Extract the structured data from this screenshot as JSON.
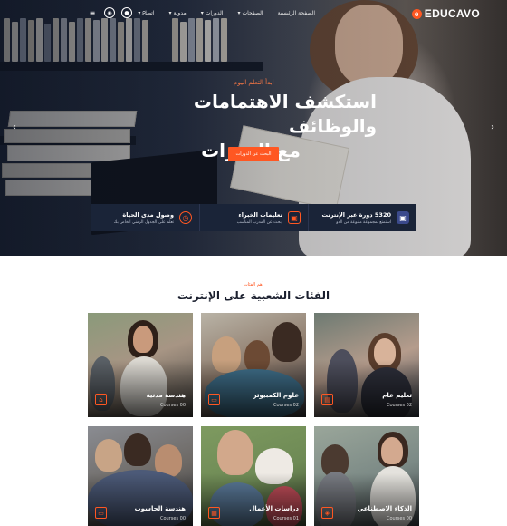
{
  "logo": {
    "text": "EDUCAVO"
  },
  "nav": {
    "items": [
      {
        "label": "الصفحة الرئيسية",
        "has_dropdown": false
      },
      {
        "label": "الصفحات",
        "has_dropdown": true
      },
      {
        "label": "الدورات",
        "has_dropdown": true
      },
      {
        "label": "مدونة",
        "has_dropdown": true
      },
      {
        "label": "اتصل",
        "has_dropdown": true
      }
    ]
  },
  "tools": {
    "menu_icon": "≡",
    "user_icon": "◉",
    "cart_icon": "●",
    "search_icon": "⌕"
  },
  "hero": {
    "eyebrow": "ابدأ التعلم اليوم",
    "headline_line1": "استكشف الاهتمامات والوظائف",
    "headline_line2": "مع الدورات",
    "button": "البحث عن الدورات",
    "prev_arrow": "‹",
    "next_arrow": "›"
  },
  "features": [
    {
      "title": "5320 دورة عبر الإنترنت",
      "subtitle": "استمتع بمجموعة متنوعة من الدو",
      "icon": "▣",
      "color": "#3b4a8c"
    },
    {
      "title": "تعليمات الخبراء",
      "subtitle": "ابحث عن المدرب المناسب",
      "icon": "▣",
      "color": "#ff5722"
    },
    {
      "title": "وصول مدى الحياة",
      "subtitle": "تعلم على الجدول الزمني الخاص بك",
      "icon": "◷",
      "color": "#ff5722"
    }
  ],
  "categories_section": {
    "eyebrow": "أهم الفئات",
    "title": "الفئات الشعبية على الإنترنت"
  },
  "categories": [
    {
      "title": "تعليم عام",
      "count": "Courses 02"
    },
    {
      "title": "علوم الكمبيوتر",
      "count": "Courses 02"
    },
    {
      "title": "هندسة مدنية",
      "count": "Courses 00"
    },
    {
      "title": "الذكاء الاصطناعي",
      "count": "Courses 00"
    },
    {
      "title": "دراسات الأعمال",
      "count": "Courses 01"
    },
    {
      "title": "هندسة الحاسوب",
      "count": "Courses 00"
    }
  ],
  "colors": {
    "accent": "#ff5722",
    "dark_navy": "#1a2438",
    "title_text": "#1a1f2e"
  }
}
